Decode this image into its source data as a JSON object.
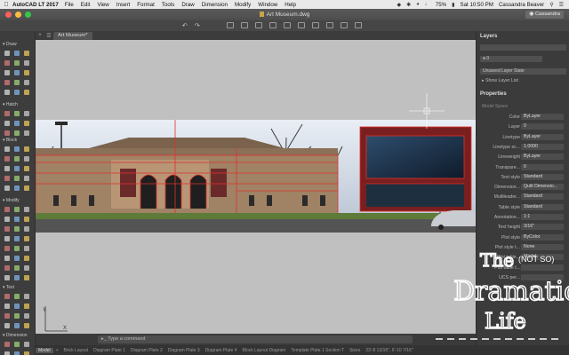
{
  "menubar": {
    "app_name": "AutoCAD LT 2017",
    "items": [
      "File",
      "Edit",
      "View",
      "Insert",
      "Format",
      "Tools",
      "Draw",
      "Dimension",
      "Modify",
      "Window",
      "Help"
    ],
    "battery": "75%",
    "clock": "Sat 10:50 PM",
    "user": "Cassandra Beaver"
  },
  "titlebar": {
    "title": "Art Museum.dwg",
    "user_badge": "Cassandra"
  },
  "tabs": {
    "document_tab": "Art Museum*"
  },
  "left_panel": {
    "sections": [
      "Draw",
      "Hatch",
      "Block",
      "Modify",
      "Text",
      "Dimension"
    ]
  },
  "command_line": {
    "placeholder": "Type a command"
  },
  "statusbar": {
    "tabs": [
      "Model",
      "Brick Layout",
      "Diagram Plate 1",
      "Diagram Plate 2",
      "Diagram Plate 3",
      "Diagram Plate 4",
      "Block Layout Diagram",
      "Template Plate 1 Section T",
      "Sizes"
    ],
    "coords": "23'-8 13/16\", 6'-10 7/16\""
  },
  "layers_panel": {
    "title": "Layers",
    "unsaved_state": "Unsaved Layer State",
    "show_list": "Show Layer List",
    "current_layer": "0"
  },
  "properties_panel": {
    "title": "Properties",
    "context": "Model Space",
    "rows": [
      {
        "label": "Color",
        "value": "ByLayer"
      },
      {
        "label": "Layer",
        "value": "0"
      },
      {
        "label": "Linetype",
        "value": "ByLayer"
      },
      {
        "label": "Linetype sc...",
        "value": "1.0000"
      },
      {
        "label": "Lineweight",
        "value": "ByLayer"
      },
      {
        "label": "Transpare...",
        "value": "0"
      },
      {
        "label": "Text style",
        "value": "Standard"
      },
      {
        "label": "Dimension...",
        "value": "Quilt Dimensio..."
      },
      {
        "label": "Multileader...",
        "value": "Standard"
      },
      {
        "label": "Table style",
        "value": "Standard"
      },
      {
        "label": "Annotation...",
        "value": "1:1"
      },
      {
        "label": "Text height",
        "value": "3/16\""
      },
      {
        "label": "Plot style",
        "value": "ByColor"
      },
      {
        "label": "Plot style t...",
        "value": "None"
      },
      {
        "label": "Plot table...",
        "value": "Model"
      },
      {
        "label": "Plot table t...",
        "value": ""
      },
      {
        "label": "UCS per...",
        "value": ""
      }
    ]
  },
  "watermark": {
    "line1": "The",
    "line1b": "(NOT SO)",
    "line2": "Dramatic",
    "line3": "Life"
  },
  "colors": {
    "accent_red": "#e0302b",
    "traffic_red": "#fc605c",
    "traffic_yellow": "#fdbc40",
    "traffic_green": "#34c84a"
  }
}
